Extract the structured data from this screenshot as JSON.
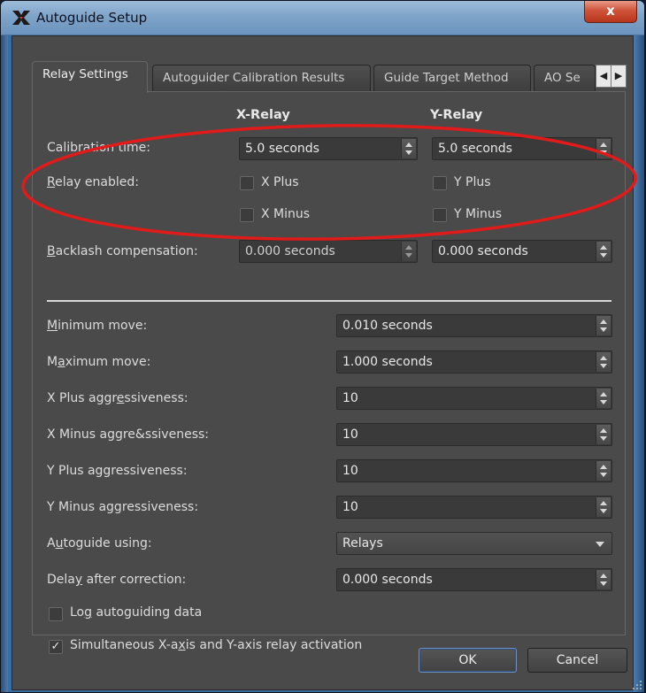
{
  "window": {
    "title": "Autoguide Setup",
    "close_glyph": "x"
  },
  "tabs": [
    {
      "label": "Relay Settings",
      "active": true
    },
    {
      "label": "Autoguider Calibration Results"
    },
    {
      "label": "Guide Target Method"
    },
    {
      "label": "AO Se"
    }
  ],
  "tab_scroll": {
    "left": "◀",
    "right": "▶"
  },
  "relay": {
    "x_header": "X-Relay",
    "y_header": "Y-Relay",
    "calibration_label": "Calibration time:",
    "x_calibration": "5.0 seconds",
    "y_calibration": "5.0 seconds",
    "relay_enabled_label_u": "R",
    "relay_enabled_label_rest": "elay enabled:",
    "x_plus": "X Plus",
    "x_minus": "X Minus",
    "y_plus": "Y Plus",
    "y_minus": "Y Minus",
    "backlash_label_u": "B",
    "backlash_label_rest": "acklash compensation:",
    "x_backlash": "0.000 seconds",
    "y_backlash": "0.000 seconds"
  },
  "settings": {
    "min_move_u": "M",
    "min_move_rest": "inimum move:",
    "min_move_value": "0.010 seconds",
    "max_move_pre": "M",
    "max_move_u": "a",
    "max_move_rest": "ximum move:",
    "max_move_value": "1.000 seconds",
    "x_plus_aggr_pre": "X Plus aggr",
    "x_plus_aggr_u": "e",
    "x_plus_aggr_rest": "ssiveness:",
    "x_plus_aggr_value": "10",
    "x_minus_aggr_label": "X Minus aggre&ssiveness:",
    "x_minus_aggr_value": "10",
    "y_plus_aggr_label": "Y Plus aggressiveness:",
    "y_plus_aggr_value": "10",
    "y_minus_aggr_label": "Y Minus aggressiveness:",
    "y_minus_aggr_value": "10",
    "autoguide_using_pre": "A",
    "autoguide_using_u": "u",
    "autoguide_using_rest": "toguide using:",
    "autoguide_using_value": "Relays",
    "delay_pre": "Dela",
    "delay_u": "y",
    "delay_rest": " after correction:",
    "delay_value": "0.000 seconds",
    "log_pre": "Lo",
    "log_u": "g",
    "log_rest": " autoguiding data",
    "log_checked": false,
    "simul_pre": "Simultaneous X-a",
    "simul_u": "x",
    "simul_rest": "is and Y-axis relay activation",
    "simul_checked": true,
    "check_glyph": "✓"
  },
  "buttons": {
    "ok": "OK",
    "cancel": "Cancel"
  },
  "colors": {
    "annotation": "#e11a1a",
    "dialog_bg": "#4a4a4a",
    "title_bar": "#7fa4c9"
  }
}
